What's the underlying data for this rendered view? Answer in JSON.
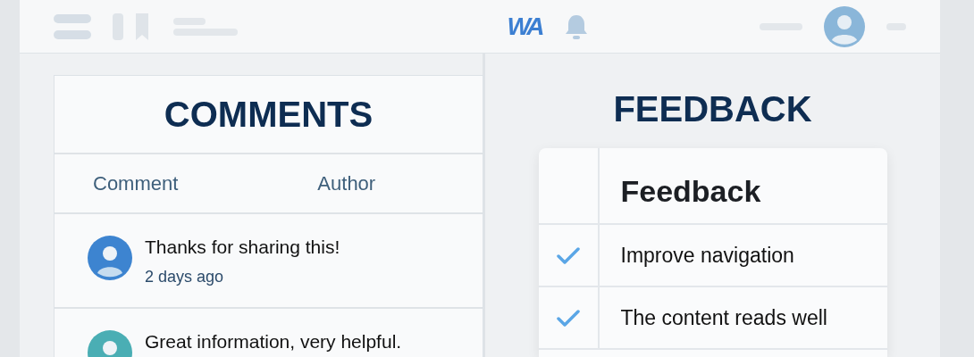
{
  "header": {
    "logo": "WA"
  },
  "comments": {
    "title": "COMMENTS",
    "columns": [
      "Comment",
      "Author"
    ],
    "rows": [
      {
        "text": "Thanks for sharing this!",
        "time": "2 days ago",
        "color": "#3d84d0"
      },
      {
        "text": "Great information, very helpful.",
        "color": "#4aaeb4"
      }
    ]
  },
  "feedback": {
    "title": "FEEDBACK",
    "table_title": "Feedback",
    "items": [
      {
        "text": "Improve navigation",
        "checked": true
      },
      {
        "text": "The content reads well",
        "checked": true
      }
    ]
  }
}
